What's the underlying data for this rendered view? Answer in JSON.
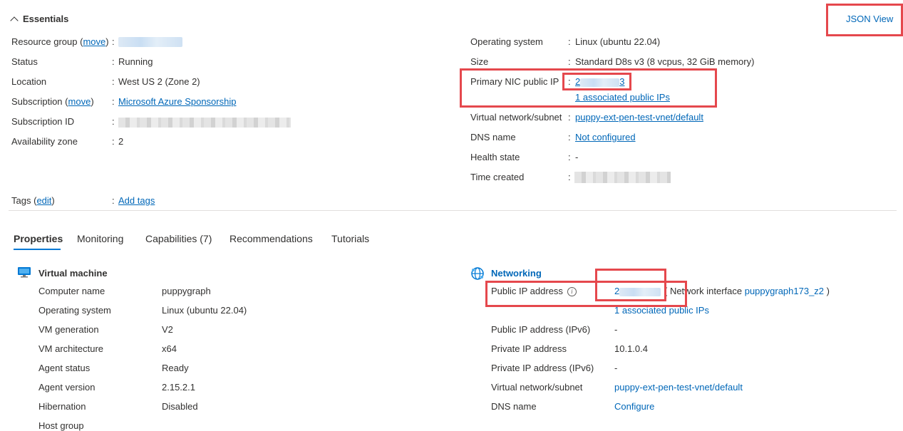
{
  "essentials": {
    "title": "Essentials",
    "json_view": "JSON View",
    "left": {
      "resource_group": {
        "label": "Resource group",
        "paren_open": "(",
        "move": "move",
        "paren_close": ")"
      },
      "status": {
        "label": "Status",
        "value": "Running"
      },
      "location": {
        "label": "Location",
        "value": "West US 2 (Zone 2)"
      },
      "subscription": {
        "label": "Subscription",
        "paren_open": "(",
        "move": "move",
        "paren_close": ")",
        "value": "Microsoft Azure Sponsorship"
      },
      "subscription_id": {
        "label": "Subscription ID"
      },
      "availability_zone": {
        "label": "Availability zone",
        "value": "2"
      }
    },
    "right": {
      "os": {
        "label": "Operating system",
        "value": "Linux (ubuntu 22.04)"
      },
      "size": {
        "label": "Size",
        "value": "Standard D8s v3 (8 vcpus, 32 GiB memory)"
      },
      "nic_ip": {
        "label": "Primary NIC public IP",
        "value_start": "2",
        "value_end": "3",
        "assoc": "1 associated public IPs"
      },
      "vnet": {
        "label": "Virtual network/subnet",
        "value": "puppy-ext-pen-test-vnet/default"
      },
      "dns": {
        "label": "DNS name",
        "value": "Not configured"
      },
      "health": {
        "label": "Health state",
        "value": "-"
      },
      "time_created": {
        "label": "Time created"
      }
    },
    "tags": {
      "label": "Tags",
      "paren_open": "(",
      "edit": "edit",
      "paren_close": ")",
      "value": "Add tags"
    },
    "colon": ":"
  },
  "tabs": [
    "Properties",
    "Monitoring",
    "Capabilities (7)",
    "Recommendations",
    "Tutorials"
  ],
  "vm": {
    "title": "Virtual machine",
    "rows": [
      {
        "label": "Computer name",
        "value": "puppygraph"
      },
      {
        "label": "Operating system",
        "value": "Linux (ubuntu 22.04)"
      },
      {
        "label": "VM generation",
        "value": "V2"
      },
      {
        "label": "VM architecture",
        "value": "x64"
      },
      {
        "label": "Agent status",
        "value": "Ready"
      },
      {
        "label": "Agent version",
        "value": "2.15.2.1"
      },
      {
        "label": "Hibernation",
        "value": "Disabled"
      },
      {
        "label": "Host group",
        "value": ""
      }
    ]
  },
  "networking": {
    "title": "Networking",
    "public_ip": {
      "label": "Public IP address",
      "value_start": "2",
      "nic_prefix": "( Network interface",
      "nic": "puppygraph173_z2",
      "nic_suffix": ")",
      "assoc": "1 associated public IPs"
    },
    "rows": [
      {
        "label": "Public IP address (IPv6)",
        "value": "-",
        "link": false
      },
      {
        "label": "Private IP address",
        "value": "10.1.0.4",
        "link": false
      },
      {
        "label": "Private IP address (IPv6)",
        "value": "-",
        "link": false
      },
      {
        "label": "Virtual network/subnet",
        "value": "puppy-ext-pen-test-vnet/default",
        "link": true
      },
      {
        "label": "DNS name",
        "value": "Configure",
        "link": true
      }
    ]
  },
  "colors": {
    "accent": "#0067b8",
    "highlight": "#e5484d",
    "tab_underline": "#0078d4"
  }
}
